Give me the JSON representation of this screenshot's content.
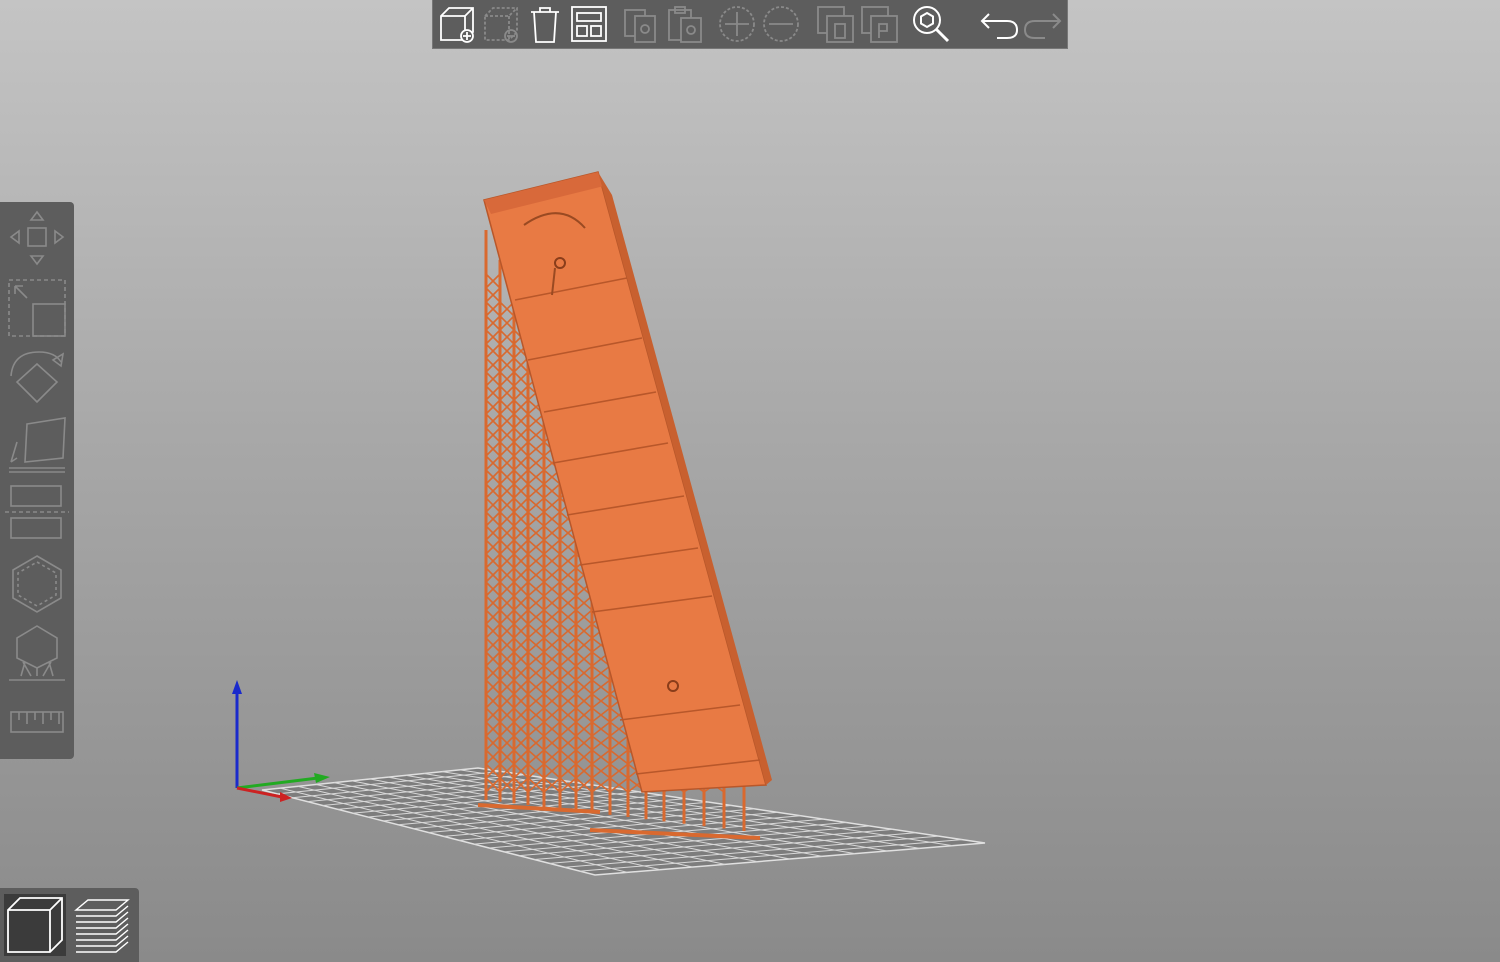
{
  "app": {
    "window_title": "3D view"
  },
  "colors": {
    "toolbar_bg": "#5d5d5d",
    "icon_active": "#ffffff",
    "icon_disabled": "#8a8a8a",
    "model": "#e5733d",
    "bed_grid": "#d8d8d8",
    "axis_x": "#cc2222",
    "axis_y": "#22aa22",
    "axis_z": "#1a2acc"
  },
  "top_toolbar": {
    "buttons": [
      {
        "id": "add",
        "icon": "add-object-icon",
        "enabled": true
      },
      {
        "id": "delete",
        "icon": "delete-object-icon",
        "enabled": false
      },
      {
        "id": "delete_all",
        "icon": "delete-all-icon",
        "enabled": true
      },
      {
        "id": "arrange",
        "icon": "arrange-icon",
        "enabled": true
      },
      {
        "id": "copy",
        "icon": "copy-icon",
        "enabled": false
      },
      {
        "id": "paste",
        "icon": "paste-icon",
        "enabled": false
      },
      {
        "id": "add_instance",
        "icon": "add-instance-icon",
        "enabled": false
      },
      {
        "id": "remove_instance",
        "icon": "remove-instance-icon",
        "enabled": false
      },
      {
        "id": "split_objects",
        "icon": "split-objects-icon",
        "enabled": false
      },
      {
        "id": "split_parts",
        "icon": "split-parts-icon",
        "enabled": false
      },
      {
        "id": "search",
        "icon": "search-icon",
        "enabled": true
      },
      {
        "id": "undo",
        "icon": "undo-icon",
        "enabled": true
      },
      {
        "id": "redo",
        "icon": "redo-icon",
        "enabled": false
      }
    ]
  },
  "gizmo_toolbar": {
    "tools": [
      {
        "id": "move",
        "icon": "move-icon"
      },
      {
        "id": "scale",
        "icon": "scale-icon"
      },
      {
        "id": "rotate",
        "icon": "rotate-icon"
      },
      {
        "id": "place_on_face",
        "icon": "place-on-face-icon"
      },
      {
        "id": "cut",
        "icon": "cut-icon"
      },
      {
        "id": "hollow",
        "icon": "hollow-icon"
      },
      {
        "id": "sla_support_points",
        "icon": "support-points-icon"
      },
      {
        "id": "measure",
        "icon": "measure-icon"
      }
    ]
  },
  "view_switch": {
    "selected": "3d",
    "items": [
      {
        "id": "3d",
        "icon": "3d-view-icon"
      },
      {
        "id": "preview",
        "icon": "preview-layers-icon"
      }
    ]
  }
}
